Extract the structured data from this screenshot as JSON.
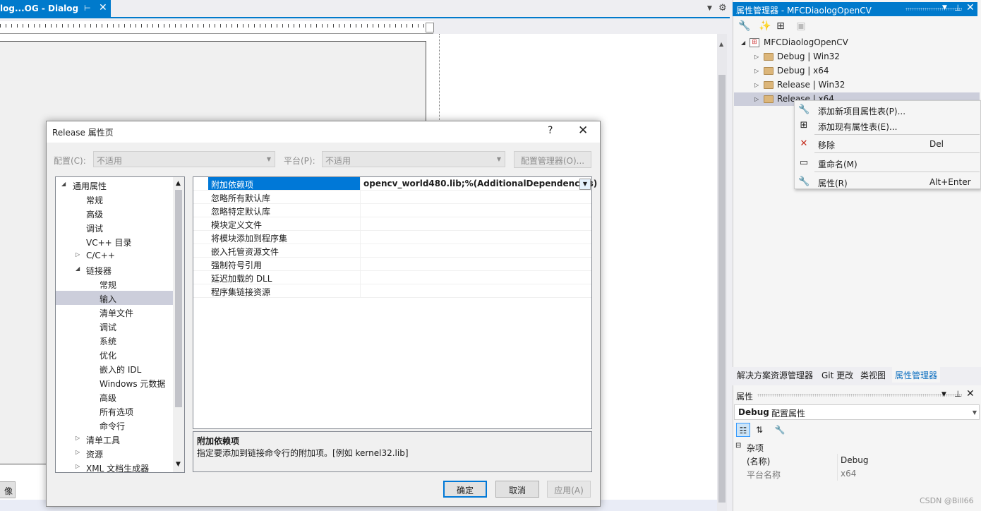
{
  "editor": {
    "tab_title": "log...OG - Dialog",
    "pin_glyph": "⊢",
    "close_glyph": "✕",
    "dropdown_glyph": "▼",
    "gear_glyph": "⚙",
    "image_button_label": "像"
  },
  "property_manager": {
    "title": "属性管理器 - MFCDiaologOpenCV",
    "root": "MFCDiaologOpenCV",
    "configs": [
      "Debug | Win32",
      "Debug | x64",
      "Release | Win32",
      "Release | x64"
    ],
    "bottom_tabs": [
      "解决方案资源管理器",
      "Git 更改",
      "类视图",
      "属性管理器"
    ]
  },
  "context_menu": {
    "items": [
      {
        "label": "添加新项目属性表(P)...",
        "shortcut": "",
        "icon": "wrench-star-icon"
      },
      {
        "label": "添加现有属性表(E)...",
        "shortcut": "",
        "icon": "add-existing-icon"
      },
      {
        "label": "移除",
        "shortcut": "Del",
        "icon": "remove-x-icon"
      },
      {
        "label": "重命名(M)",
        "shortcut": "",
        "icon": "rename-icon"
      },
      {
        "label": "属性(R)",
        "shortcut": "Alt+Enter",
        "icon": "wrench-icon"
      }
    ]
  },
  "properties_panel": {
    "title": "属性",
    "selector_bold": "Debug",
    "selector_rest": "配置属性",
    "category": "杂项",
    "rows": [
      {
        "name": "(名称)",
        "value": "Debug"
      },
      {
        "name": "平台名称",
        "value": "x64"
      }
    ]
  },
  "dialog": {
    "title": "Release 属性页",
    "help": "?",
    "config_label": "配置(C):",
    "config_value": "不适用",
    "platform_label": "平台(P):",
    "platform_value": "不适用",
    "config_manager_button": "配置管理器(O)...",
    "nav_tree": [
      {
        "label": "通用属性",
        "level": 0,
        "expander": "expanded"
      },
      {
        "label": "常规",
        "level": 1,
        "expander": "none"
      },
      {
        "label": "高级",
        "level": 1,
        "expander": "none"
      },
      {
        "label": "调试",
        "level": 1,
        "expander": "none"
      },
      {
        "label": "VC++ 目录",
        "level": 1,
        "expander": "none"
      },
      {
        "label": "C/C++",
        "level": 1,
        "expander": "collapsed"
      },
      {
        "label": "链接器",
        "level": 1,
        "expander": "expanded"
      },
      {
        "label": "常规",
        "level": 2,
        "expander": "none"
      },
      {
        "label": "输入",
        "level": 2,
        "expander": "none",
        "selected": true
      },
      {
        "label": "清单文件",
        "level": 2,
        "expander": "none"
      },
      {
        "label": "调试",
        "level": 2,
        "expander": "none"
      },
      {
        "label": "系统",
        "level": 2,
        "expander": "none"
      },
      {
        "label": "优化",
        "level": 2,
        "expander": "none"
      },
      {
        "label": "嵌入的 IDL",
        "level": 2,
        "expander": "none"
      },
      {
        "label": "Windows 元数据",
        "level": 2,
        "expander": "none"
      },
      {
        "label": "高级",
        "level": 2,
        "expander": "none"
      },
      {
        "label": "所有选项",
        "level": 2,
        "expander": "none"
      },
      {
        "label": "命令行",
        "level": 2,
        "expander": "none"
      },
      {
        "label": "清单工具",
        "level": 1,
        "expander": "collapsed"
      },
      {
        "label": "资源",
        "level": 1,
        "expander": "collapsed"
      },
      {
        "label": "XML 文档生成器",
        "level": 1,
        "expander": "collapsed"
      }
    ],
    "grid": [
      {
        "name": "附加依赖项",
        "value": "opencv_world480.lib;%(AdditionalDependencies)",
        "selected": true
      },
      {
        "name": "忽略所有默认库",
        "value": ""
      },
      {
        "name": "忽略特定默认库",
        "value": ""
      },
      {
        "name": "模块定义文件",
        "value": ""
      },
      {
        "name": "将模块添加到程序集",
        "value": ""
      },
      {
        "name": "嵌入托管资源文件",
        "value": ""
      },
      {
        "name": "强制符号引用",
        "value": ""
      },
      {
        "name": "延迟加载的 DLL",
        "value": ""
      },
      {
        "name": "程序集链接资源",
        "value": ""
      }
    ],
    "description_title": "附加依赖项",
    "description_text": "指定要添加到链接命令行的附加项。[例如 kernel32.lib]",
    "ok": "确定",
    "cancel": "取消",
    "apply": "应用(A)"
  },
  "watermark": "CSDN @Bill66",
  "colors": {
    "accent": "#007acc",
    "selection": "#0078d7",
    "tree_selection": "#cccedb"
  }
}
